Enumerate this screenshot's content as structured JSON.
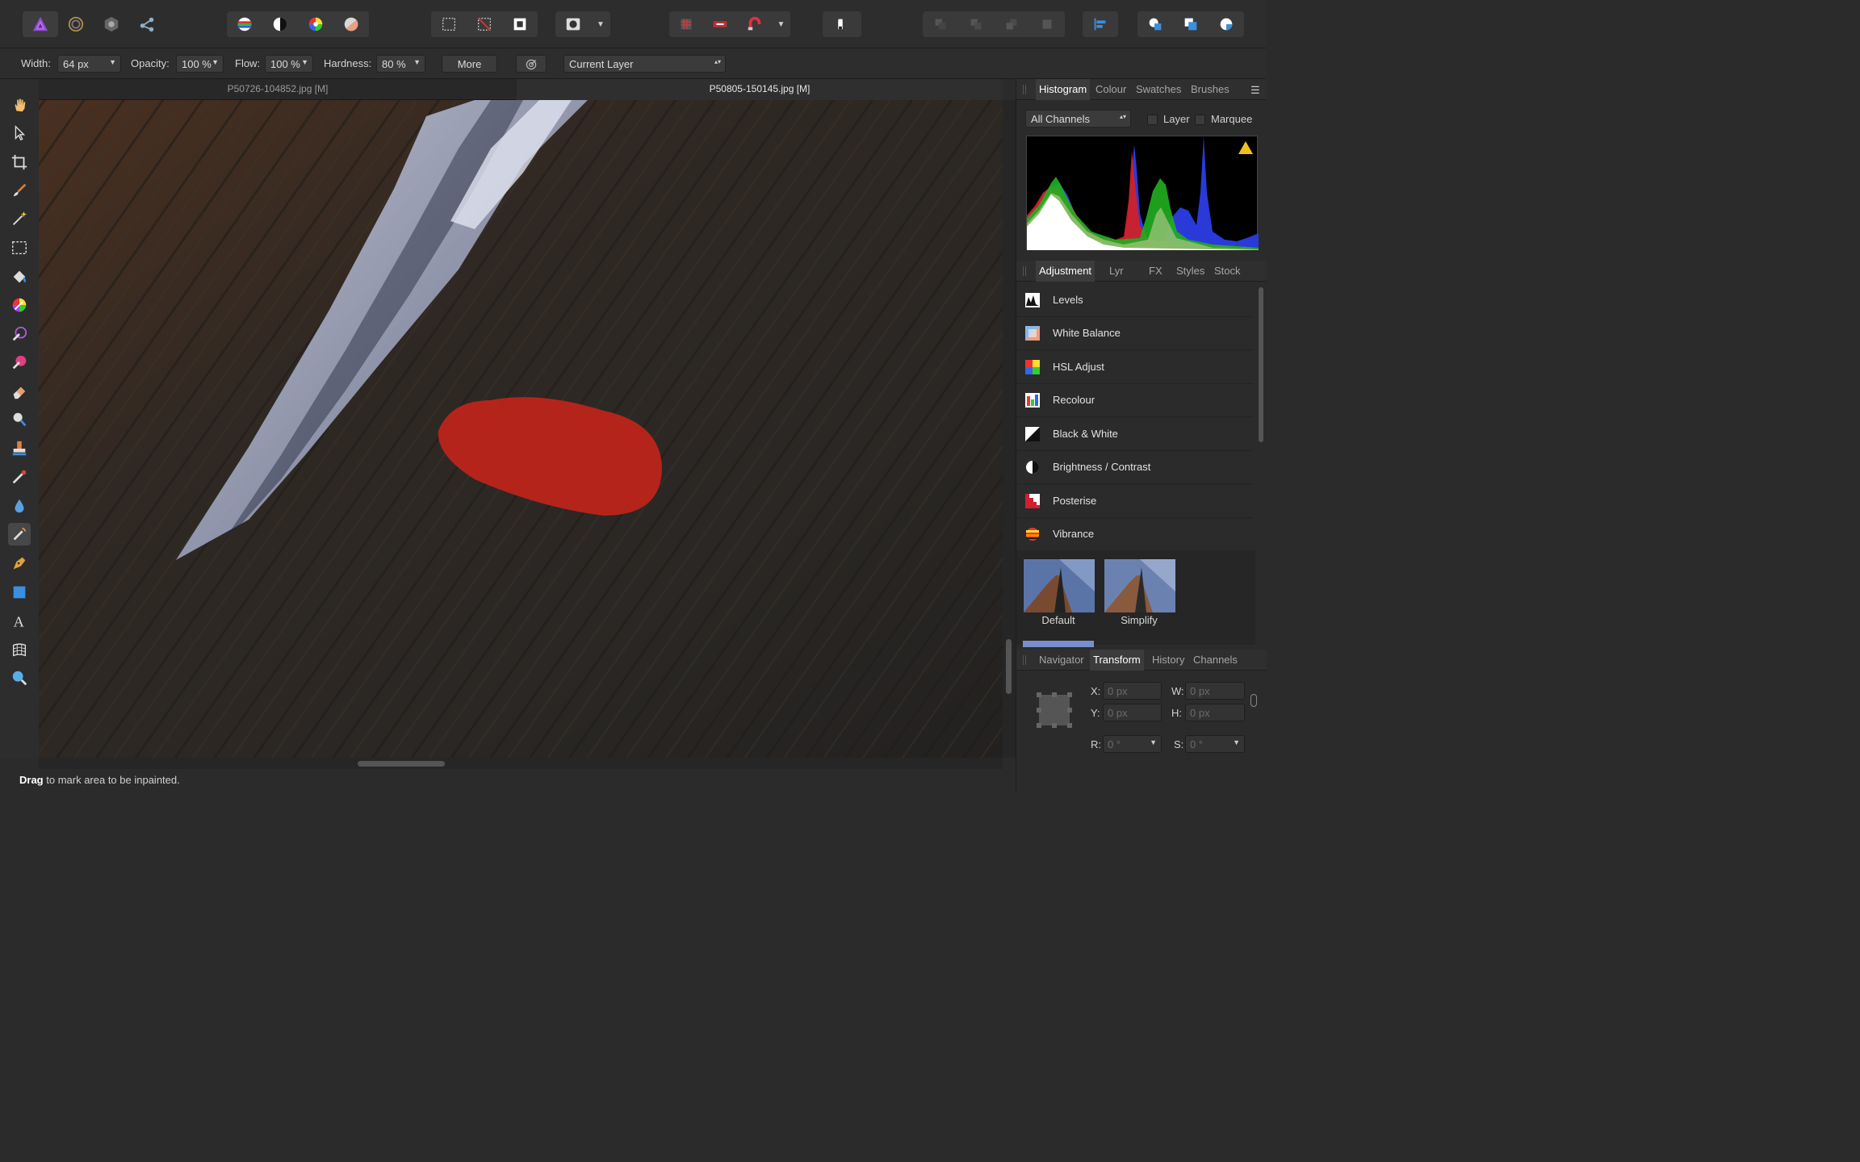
{
  "context_bar": {
    "width_label": "Width:",
    "width_value": "64 px",
    "opacity_label": "Opacity:",
    "opacity_value": "100 %",
    "flow_label": "Flow:",
    "flow_value": "100 %",
    "hardness_label": "Hardness:",
    "hardness_value": "80 %",
    "more_label": "More",
    "layer_select_value": "Current Layer"
  },
  "documents": {
    "tabs": [
      {
        "label": "P50726-104852.jpg [M]"
      },
      {
        "label": "P50805-150145.jpg [M]"
      }
    ]
  },
  "status": {
    "bold": "Drag",
    "text": " to mark area to be inpainted."
  },
  "histogram_panel": {
    "tabs": [
      "Histogram",
      "Colour",
      "Swatches",
      "Brushes"
    ],
    "channel_select": "All Channels",
    "layer_label": "Layer",
    "marquee_label": "Marquee"
  },
  "adjustment_panel": {
    "tabs": [
      "Adjustment",
      "Lyr",
      "FX",
      "Styles",
      "Stock"
    ],
    "items": [
      {
        "label": "Levels"
      },
      {
        "label": "White Balance"
      },
      {
        "label": "HSL Adjust"
      },
      {
        "label": "Recolour"
      },
      {
        "label": "Black & White"
      },
      {
        "label": "Brightness / Contrast"
      },
      {
        "label": "Posterise"
      },
      {
        "label": "Vibrance"
      }
    ],
    "presets": [
      {
        "label": "Default"
      },
      {
        "label": "Simplify"
      }
    ]
  },
  "transform_panel": {
    "tabs": [
      "Navigator",
      "Transform",
      "History",
      "Channels"
    ],
    "x_label": "X:",
    "x_value": "0 px",
    "y_label": "Y:",
    "y_value": "0 px",
    "w_label": "W:",
    "w_value": "0 px",
    "h_label": "H:",
    "h_value": "0 px",
    "r_label": "R:",
    "r_value": "0 °",
    "s_label": "S:",
    "s_value": "0 °"
  },
  "colors": {
    "accent_blue": "#3a8fe0",
    "inpaint_mask_red": "#c0241a",
    "panel_bg": "#2b2b2b"
  },
  "icons": {
    "top_toolbar": [
      "affinity-photo-persona-icon",
      "liquify-persona-icon",
      "develop-persona-icon",
      "export-persona-icon",
      "auto-levels-icon",
      "auto-contrast-icon",
      "auto-colours-icon",
      "auto-white-balance-icon",
      "marquee-selection-icon",
      "deselect-icon",
      "invert-selection-icon",
      "quick-mask-icon",
      "snapping-grid-icon",
      "assistant-icon",
      "magnet-snapping-icon",
      "erase-icon",
      "arrange-icons",
      "align-icon",
      "boolean-icons"
    ],
    "tools": [
      "hand-icon",
      "move-icon",
      "crop-icon",
      "paint-brush-icon",
      "magic-wand-icon",
      "marquee-icon",
      "flood-fill-icon",
      "color-picker-icon",
      "selection-brush-icon",
      "refine-brush-icon",
      "eraser-icon",
      "dodge-icon",
      "clone-icon",
      "healing-icon",
      "blur-icon",
      "inpainting-icon",
      "pen-icon",
      "rectangle-icon",
      "text-icon",
      "mesh-warp-icon",
      "zoom-icon"
    ]
  }
}
